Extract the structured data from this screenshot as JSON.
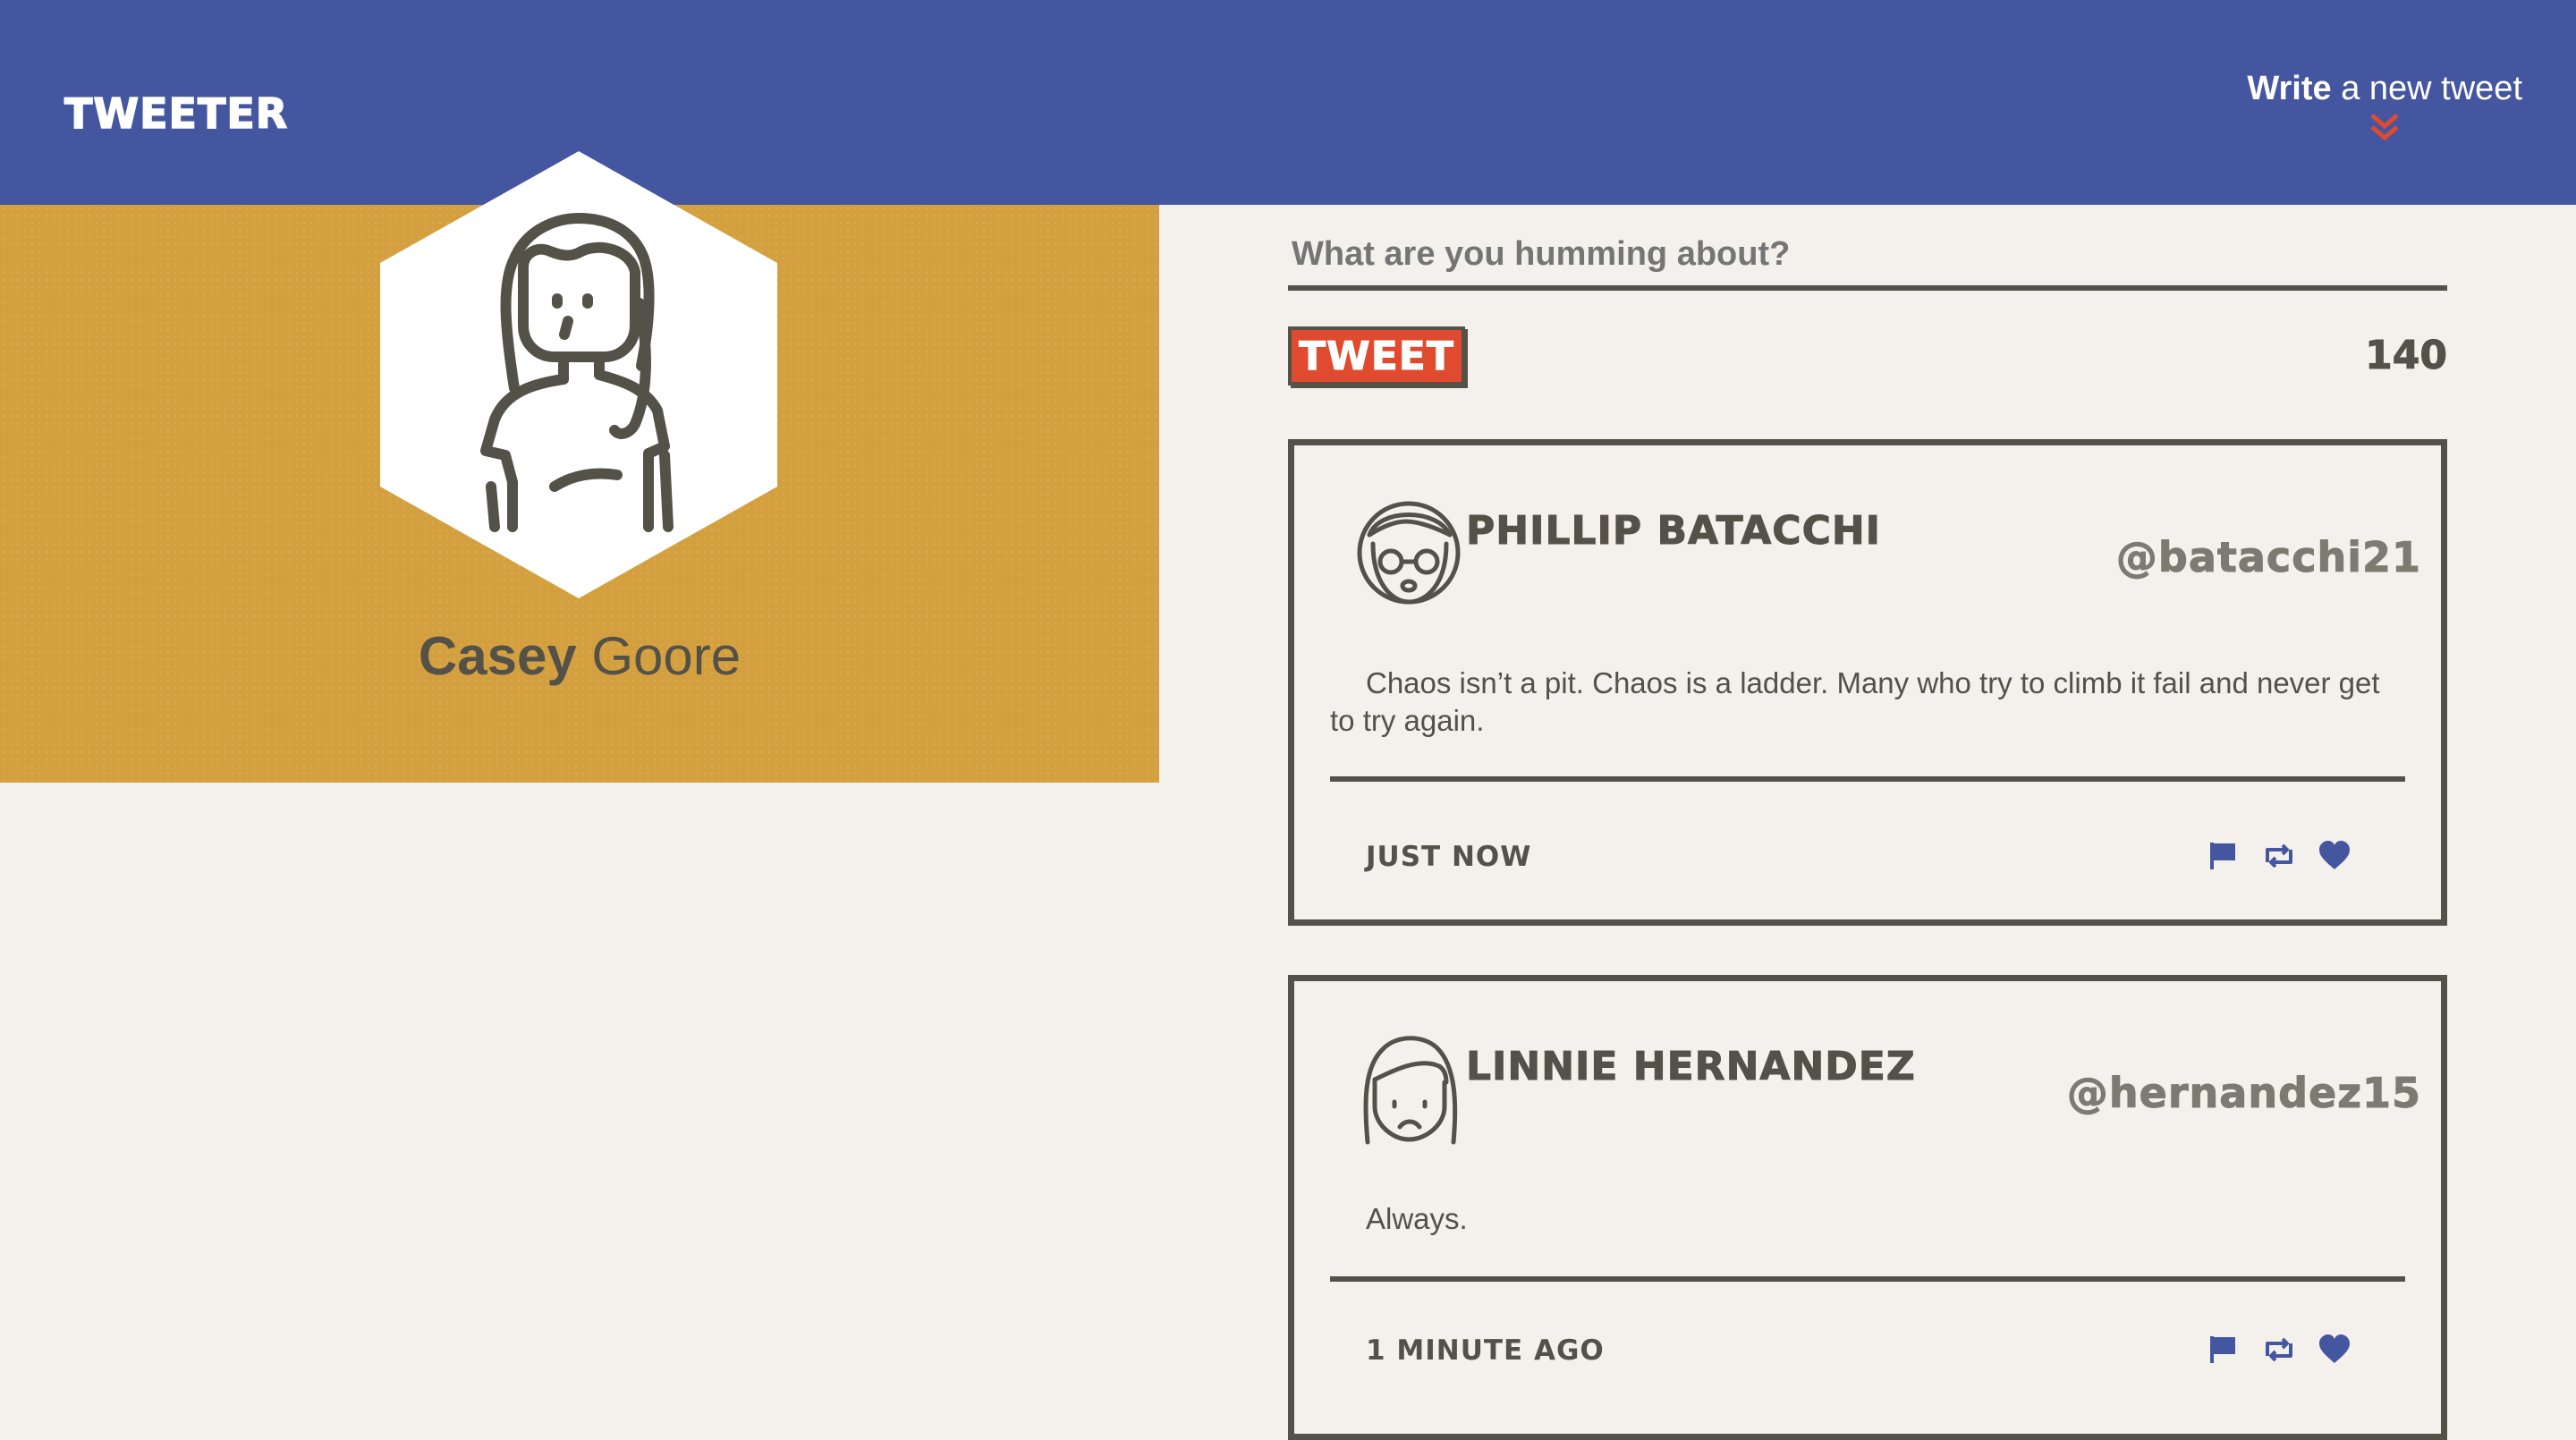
{
  "nav": {
    "brand": "TWEETER",
    "compose_strong": "Write",
    "compose_rest": " a new tweet",
    "compose_icon": "double-chevron-down-icon"
  },
  "profile": {
    "first_name": "Casey",
    "last_name": " Goore"
  },
  "composer": {
    "placeholder": "What are you humming about?",
    "button_label": "TWEET",
    "char_counter": "140"
  },
  "tweets": [
    {
      "name": "Phillip Batacchi",
      "handle": "@batacchi21",
      "text": "Chaos isn’t a pit. Chaos is a ladder. Many who try to climb it fail and never get to try again.",
      "timestamp": "just now",
      "actions": [
        "flag-icon",
        "retweet-icon",
        "heart-icon"
      ]
    },
    {
      "name": "Linnie Hernandez",
      "handle": "@hernandez15",
      "text": "Always.",
      "timestamp": "1 minute ago",
      "actions": [
        "flag-icon",
        "retweet-icon",
        "heart-icon"
      ]
    }
  ],
  "colors": {
    "nav_bg": "#4556a0",
    "profile_bg": "#d4a03f",
    "page_bg": "#f4f1ec",
    "accent_red": "#e04a2f",
    "text_dark": "#545149",
    "icon_blue": "#4556a0"
  }
}
